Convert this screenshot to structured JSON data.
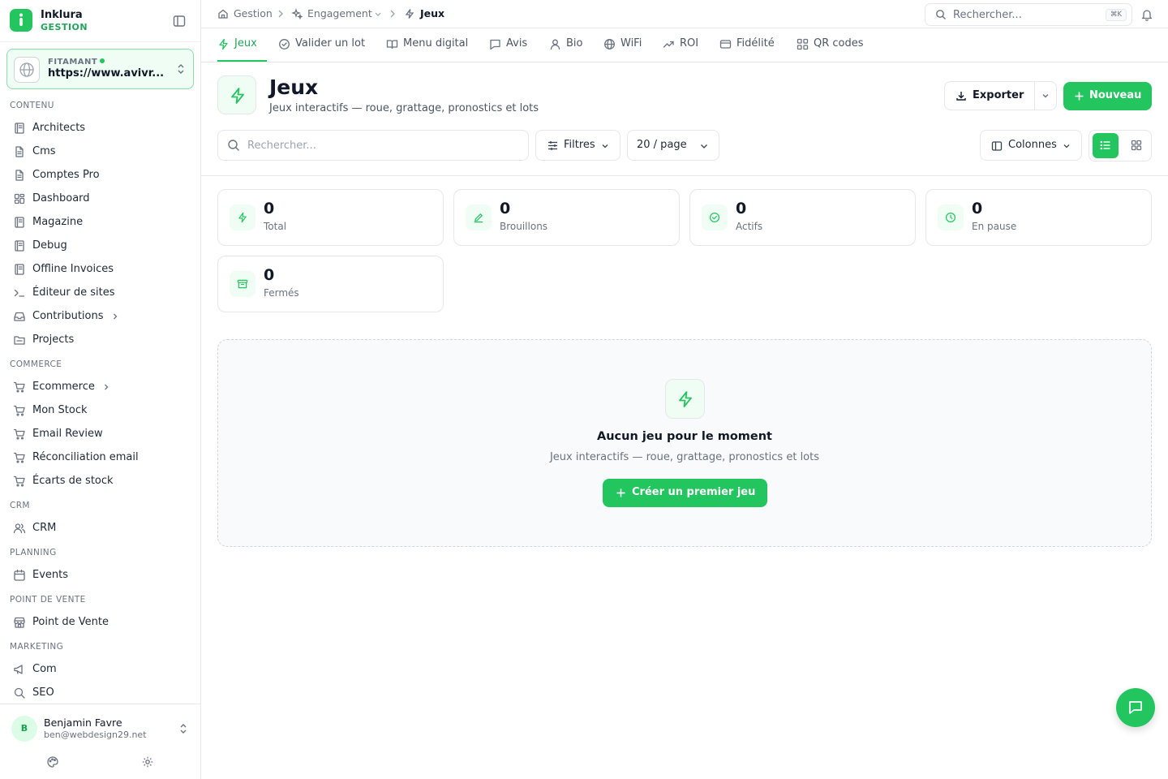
{
  "brand": {
    "name": "Inklura",
    "subtitle": "GESTION"
  },
  "site": {
    "label": "FITAMANT",
    "url": "https://www.avivr..."
  },
  "sidebar": {
    "sections": [
      {
        "title": "CONTENU",
        "items": [
          {
            "label": "Architects",
            "icon": "book-icon"
          },
          {
            "label": "Cms",
            "icon": "file-icon"
          },
          {
            "label": "Comptes Pro",
            "icon": "file-icon"
          },
          {
            "label": "Dashboard",
            "icon": "grid-icon"
          },
          {
            "label": "Magazine",
            "icon": "book-icon"
          },
          {
            "label": "Debug",
            "icon": "book-icon"
          },
          {
            "label": "Offline Invoices",
            "icon": "book-icon"
          },
          {
            "label": "Éditeur de sites",
            "icon": "terminal-icon"
          },
          {
            "label": "Contributions",
            "icon": "inbox-icon",
            "expandable": true
          },
          {
            "label": "Projects",
            "icon": "folder-icon"
          }
        ]
      },
      {
        "title": "COMMERCE",
        "items": [
          {
            "label": "Ecommerce",
            "icon": "cart-icon",
            "expandable": true
          },
          {
            "label": "Mon Stock",
            "icon": "cart-icon"
          },
          {
            "label": "Email Review",
            "icon": "cart-icon"
          },
          {
            "label": "Réconciliation email",
            "icon": "cart-icon"
          },
          {
            "label": "Écarts de stock",
            "icon": "cart-icon"
          }
        ]
      },
      {
        "title": "CRM",
        "items": [
          {
            "label": "CRM",
            "icon": "users-icon"
          }
        ]
      },
      {
        "title": "PLANNING",
        "items": [
          {
            "label": "Events",
            "icon": "calendar-icon"
          }
        ]
      },
      {
        "title": "POINT DE VENTE",
        "items": [
          {
            "label": "Point de Vente",
            "icon": "store-icon"
          }
        ]
      },
      {
        "title": "MARKETING",
        "items": [
          {
            "label": "Com",
            "icon": "megaphone-icon"
          },
          {
            "label": "SEO",
            "icon": "search-icon"
          }
        ]
      }
    ]
  },
  "user": {
    "initial": "B",
    "name": "Benjamin Favre",
    "email": "ben@webdesign29.net"
  },
  "breadcrumb": {
    "home": "Gestion",
    "section": "Engagement",
    "current": "Jeux"
  },
  "global_search": {
    "placeholder": "Rechercher...",
    "shortcut": "⌘K"
  },
  "tabs": [
    {
      "label": "Jeux",
      "icon": "zap-icon",
      "active": true
    },
    {
      "label": "Valider un lot",
      "icon": "check-circle-icon"
    },
    {
      "label": "Menu digital",
      "icon": "book-open-icon"
    },
    {
      "label": "Avis",
      "icon": "message-icon"
    },
    {
      "label": "Bio",
      "icon": "user-icon"
    },
    {
      "label": "WiFi",
      "icon": "globe-icon"
    },
    {
      "label": "ROI",
      "icon": "trending-up-icon"
    },
    {
      "label": "Fidélité",
      "icon": "card-icon"
    },
    {
      "label": "QR codes",
      "icon": "qr-icon"
    }
  ],
  "page": {
    "title": "Jeux",
    "subtitle": "Jeux interactifs — roue, grattage, pronostics et lots"
  },
  "actions": {
    "export_label": "Exporter",
    "new_label": "Nouveau"
  },
  "filters": {
    "search_placeholder": "Rechercher...",
    "filters_label": "Filtres",
    "per_page": "20 / page",
    "columns_label": "Colonnes"
  },
  "stats": [
    {
      "value": "0",
      "label": "Total",
      "icon": "zap-icon"
    },
    {
      "value": "0",
      "label": "Brouillons",
      "icon": "pencil-icon"
    },
    {
      "value": "0",
      "label": "Actifs",
      "icon": "check-circle-icon"
    },
    {
      "value": "0",
      "label": "En pause",
      "icon": "clock-icon"
    },
    {
      "value": "0",
      "label": "Fermés",
      "icon": "archive-icon"
    }
  ],
  "empty": {
    "title": "Aucun jeu pour le moment",
    "subtitle": "Jeux interactifs — roue, grattage, pronostics et lots",
    "cta": "Créer un premier jeu"
  },
  "colors": {
    "accent": "#22c55e",
    "accent_text": "#22a55a",
    "border": "#e5e7eb"
  }
}
